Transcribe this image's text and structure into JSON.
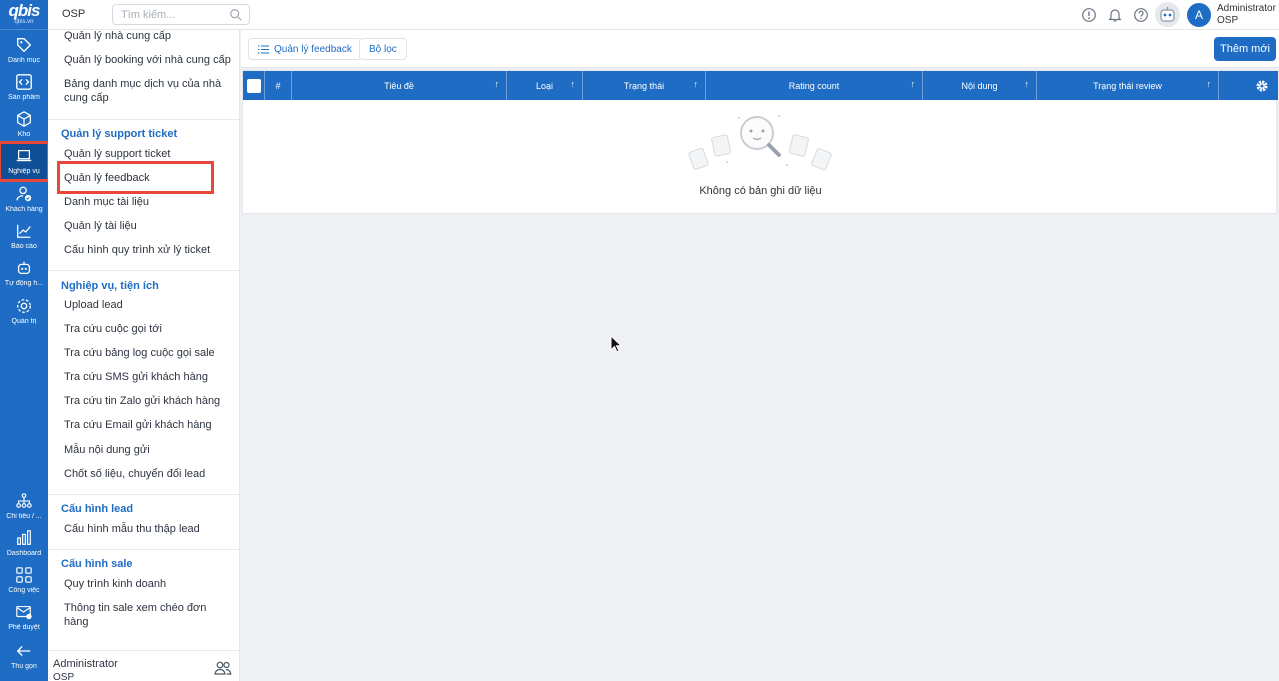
{
  "brand": {
    "logo": "qbis",
    "logo_sub": "qbis.vn"
  },
  "rail": [
    {
      "label": "Danh mục",
      "icon": "tag-icon"
    },
    {
      "label": "Sản phẩm",
      "icon": "code-box-icon"
    },
    {
      "label": "Kho",
      "icon": "box-icon"
    },
    {
      "label": "Nghiệp vụ",
      "icon": "laptop-icon"
    },
    {
      "label": "Khách hàng",
      "icon": "user-check-icon"
    },
    {
      "label": "Báo cáo",
      "icon": "chart-line-icon"
    },
    {
      "label": "Tự động h...",
      "icon": "robot-icon"
    },
    {
      "label": "Quản trị",
      "icon": "gear-icon"
    },
    {
      "label": "Chỉ tiêu / ...",
      "icon": "hierarchy-icon"
    },
    {
      "label": "Dashboard",
      "icon": "bar-chart-icon"
    },
    {
      "label": "Công việc",
      "icon": "grid-check-icon"
    },
    {
      "label": "Phê duyệt",
      "icon": "mail-check-icon"
    },
    {
      "label": "Thu gọn",
      "icon": "arrow-left-icon"
    }
  ],
  "topbar": {
    "org": "OSP",
    "search_placeholder": "Tìm kiếm...",
    "user_initial": "A",
    "user_name": "Administrator",
    "user_org": "OSP"
  },
  "menu": {
    "top_items": [
      "Quản lý nhà cung cấp",
      "Quản lý booking với nhà cung cấp",
      "Bảng danh mục dịch vụ của nhà cung cấp"
    ],
    "sections": [
      {
        "title": "Quản lý support ticket",
        "items": [
          "Quản lý support ticket",
          "Quản lý feedback",
          "Danh mục tài liệu",
          "Quản lý tài liệu",
          "Cấu hình quy trình xử lý ticket"
        ]
      },
      {
        "title": "Nghiệp vụ, tiện ích",
        "items": [
          "Upload lead",
          "Tra cứu cuộc gọi tới",
          "Tra cứu bảng log cuộc gọi sale",
          "Tra cứu SMS gửi khách hàng",
          "Tra cứu tin Zalo gửi khách hàng",
          "Tra cứu Email gửi khách hàng",
          "Mẫu nội dung gửi",
          "Chốt số liệu, chuyển đổi lead"
        ]
      },
      {
        "title": "Cấu hình lead",
        "items": [
          "Cấu hình mẫu thu thập lead"
        ]
      },
      {
        "title": "Cấu hình sale",
        "items": [
          "Quy trình kinh doanh",
          "Thông tin sale xem chéo đơn hàng"
        ]
      }
    ],
    "footer_name": "Administrator",
    "footer_org": "OSP"
  },
  "toolbar": {
    "view_label": "Quản lý feedback",
    "filter_label": "Bộ lọc",
    "add_label": "Thêm mới"
  },
  "table": {
    "columns": [
      "#",
      "Tiêu đề",
      "Loại",
      "Trạng thái",
      "Rating count",
      "Nội dung",
      "Trạng thái review"
    ],
    "empty_text": "Không có bản ghi dữ liệu"
  },
  "colors": {
    "primary": "#1e6cc4",
    "highlight": "#e8473a"
  }
}
